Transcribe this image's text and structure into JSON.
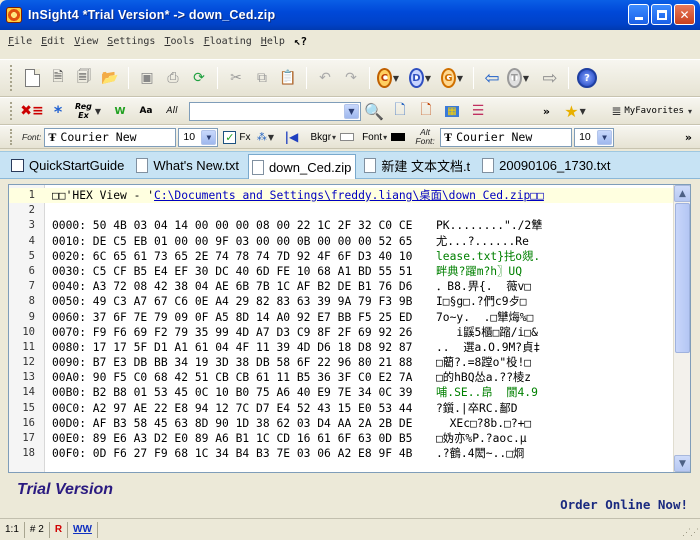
{
  "window": {
    "title": "InSight4  *Trial Version*  ->   down_Ced.zip"
  },
  "menu": [
    "File",
    "Edit",
    "View",
    "Settings",
    "Tools",
    "Floating",
    "Help"
  ],
  "toolbar": {
    "circle_labels": [
      "C",
      "D",
      "G",
      "T"
    ],
    "regex_label": "Reg Ex",
    "word_label": "W",
    "case_label": "Aa",
    "all_label": "All",
    "search_value": "",
    "favorites_label": "MyFavorites"
  },
  "format_bar": {
    "font_label": "Font:",
    "font_name": "Courier New",
    "font_size": "10",
    "fx_label": "Fx",
    "bkgr_label": "Bkgr",
    "font_color_label": "Font",
    "alt_label": "Alt Font:",
    "alt_font_name": "Courier New",
    "alt_font_size": "10"
  },
  "tabs": [
    {
      "label": "QuickStartGuide",
      "active": false
    },
    {
      "label": "What's New.txt",
      "active": false
    },
    {
      "label": "down_Ced.zip",
      "active": true
    },
    {
      "label": "新建 文本文档.t",
      "active": false
    },
    {
      "label": "20090106_1730.txt",
      "active": false
    }
  ],
  "editor": {
    "header_prefix": "□□'HEX View - '",
    "header_path": "C:\\Documents and Settings\\freddy.liang\\桌面\\down Ced.zip□□",
    "rows": [
      {
        "ln": "3",
        "hex": "0000: 50 4B 03 04 14 00 00 00 08 00 22 1C 2F 32 C0 CE",
        "ascii": "PK........\"./2犨"
      },
      {
        "ln": "4",
        "hex": "0010: DE C5 EB 01 00 00 9F 03 00 00 0B 00 00 00 52 65",
        "ascii": "尤...?......Re"
      },
      {
        "ln": "5",
        "hex": "0020: 6C 65 61 73 65 2E 74 78 74 7D 92 4F 6F D3 40 10",
        "ascii": "lease.txt}扥o覢."
      },
      {
        "ln": "6",
        "hex": "0030: C5 CF B5 E4 EF 30 DC 40 6D FE 10 68 A1 BD 55 51",
        "ascii": "畔典?躍m?h〗UQ"
      },
      {
        "ln": "7",
        "hex": "0040: A3 72 08 42 38 04 AE 6B 7B 1C AF B2 DE B1 76 D6",
        "ascii": "．B8.畀{.  薇v□"
      },
      {
        "ln": "8",
        "hex": "0050: 49 C3 A7 67 C6 0E A4 29 82 83 63 39 9A 79 F3 9B",
        "ascii": "I□§g□.?們c9歺□"
      },
      {
        "ln": "9",
        "hex": "0060: 37 6F 7E 79 09 0F A5 8D 14 A0 92 E7 BB F5 25 ED",
        "ascii": "7o~y.  .□犫烸%□"
      },
      {
        "ln": "10",
        "hex": "0070: F9 F6 69 F2 79 35 99 4D A7 D3 C9 8F 2F 69 92 26",
        "ascii": "   i鼷5櫃□蹜/i□&"
      },
      {
        "ln": "11",
        "hex": "0080: 17 17 5F D1 A1 61 04 4F 11 39 4D D6 18 D8 92 87",
        "ascii": "..  選a.O.9M?貞‡"
      },
      {
        "ln": "12",
        "hex": "0090: B7 E3 DB BB 34 19 3D 38 DB 58 6F 22 96 80 21 88",
        "ascii": "□藺?.=8蹚o\"杸!□"
      },
      {
        "ln": "13",
        "hex": "00A0: 90 F5 C0 68 42 51 CB CB 61 11 B5 36 3F C0 E2 7A",
        "ascii": "□的hBQ怂a.??棱z"
      },
      {
        "ln": "14",
        "hex": "00B0: B2 B8 01 53 45 0C 10 B0 75 A6 40 E9 7E 34 0C 39",
        "ascii": "哺.SE..皍  閬4.9"
      },
      {
        "ln": "15",
        "hex": "00C0: A2 97 AE 22 E8 94 12 7C D7 E4 52 43 15 E0 53 44",
        "ascii": "?鑕.|卒RC.鄐D"
      },
      {
        "ln": "16",
        "hex": "00D0: AF B3 58 45 63 8D 90 1D 38 62 03 D4 AA 2A 2B DE",
        "ascii": "  XEc□?8b.□?+□"
      },
      {
        "ln": "17",
        "hex": "00E0: 89 E6 A3 D2 E0 89 A6 B1 1C CD 16 61 6F 63 0D B5",
        "ascii": "□妫亦%P.?aoc.μ"
      },
      {
        "ln": "18",
        "hex": "00F0: 0D F6 27 F9 68 1C 34 B4 B3 7E 03 06 A2 E8 9F 4B",
        "ascii": ".?鶴.4閎~..□烱"
      }
    ]
  },
  "trial": {
    "label": "Trial Version",
    "order": "Order Online Now!"
  },
  "status": {
    "position": "1:1",
    "count": "# 2",
    "r_label": "R",
    "ww_label": "WW"
  },
  "colors": {
    "title_blue": "#0048d8",
    "tab_bar": "#c7e3f4",
    "ascii_green": "#008000",
    "link_blue": "#0000c0",
    "trial_purple": "#2a1a80"
  }
}
